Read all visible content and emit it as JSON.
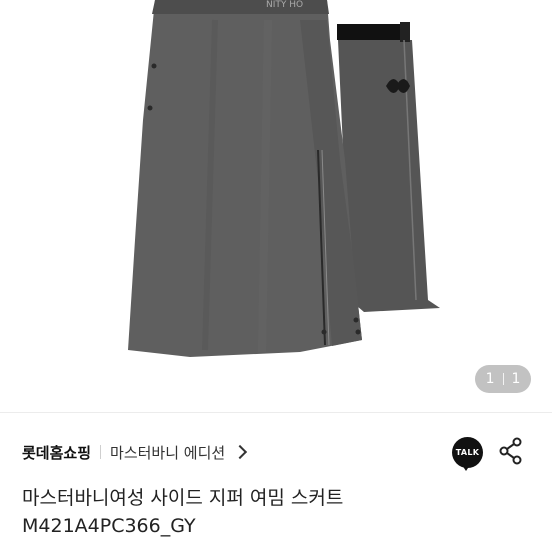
{
  "gallery": {
    "current": "1",
    "total": "1",
    "image_alt": "gray side-zip wrap skirt product photo"
  },
  "seller": {
    "name": "롯데홈쇼핑",
    "brand": "마스터바니 에디션"
  },
  "actions": {
    "talk_label": "TALK"
  },
  "product": {
    "title_line1": "마스터바니여성 사이드 지퍼 여밈 스커트",
    "title_line2": "M421A4PC366_GY"
  },
  "colors": {
    "skirt": "#5d5d5d",
    "waistband": "#111111",
    "counter_bg": "#8a8a8a"
  }
}
